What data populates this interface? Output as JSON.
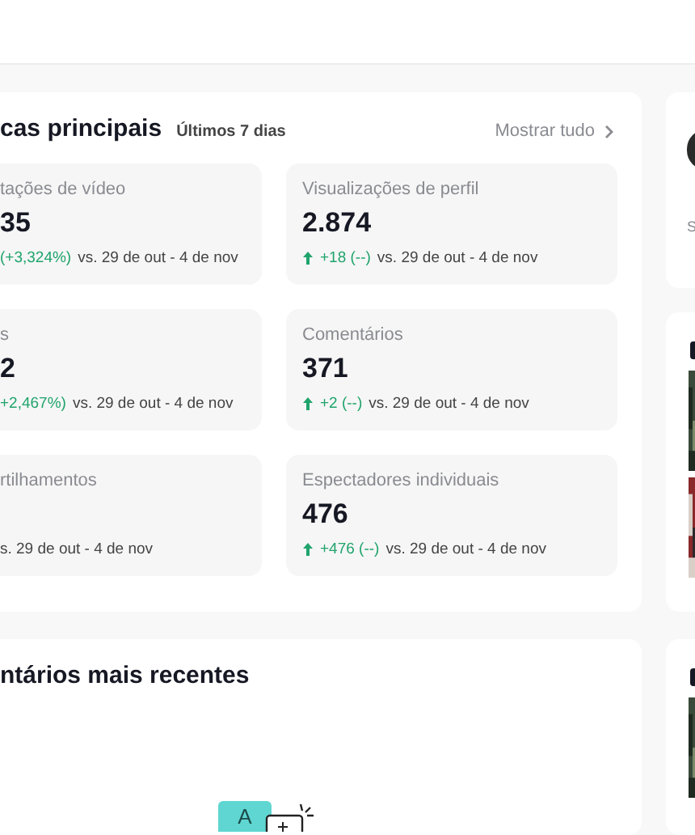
{
  "main_panel": {
    "title": "cas principais",
    "period": "Últimos 7 dias",
    "show_all": "Mostrar tudo",
    "metrics": [
      {
        "label": "tações de vídeo",
        "value": "35",
        "arrow_visible": false,
        "change": "(+3,324%)",
        "comparison": "vs. 29 de out - 4 de nov"
      },
      {
        "label": "Visualizações de perfil",
        "value": "2.874",
        "arrow_visible": true,
        "change": "+18 (--)",
        "comparison": "vs. 29 de out - 4 de nov"
      },
      {
        "label": "s",
        "value": "2",
        "arrow_visible": false,
        "change": "+2,467%)",
        "comparison": "vs. 29 de out - 4 de nov"
      },
      {
        "label": "Comentários",
        "value": "371",
        "arrow_visible": true,
        "change": "+2 (--)",
        "comparison": "vs. 29 de out - 4 de nov"
      },
      {
        "label": "rtilhamentos",
        "arrow_visible": false,
        "comparison": "s. 29 de out - 4 de nov"
      },
      {
        "label": "Espectadores individuais",
        "value": "476",
        "arrow_visible": true,
        "change": "+476 (--)",
        "comparison": "vs. 29 de out - 4 de nov"
      }
    ]
  },
  "comments_panel": {
    "title": "ntários mais recentes",
    "illustration_letter": "A"
  },
  "side_panels": [
    {
      "kind": "profile",
      "text": "S"
    },
    {
      "kind": "videos"
    },
    {
      "kind": "videos"
    }
  ]
}
